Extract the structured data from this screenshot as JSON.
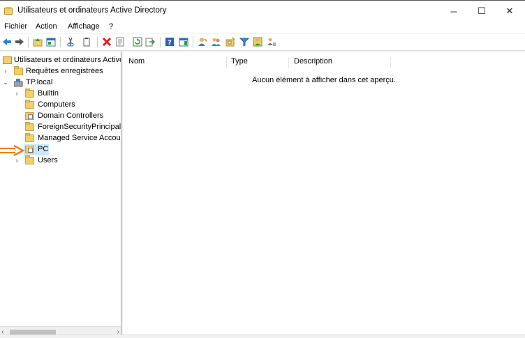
{
  "window": {
    "title": "Utilisateurs et ordinateurs Active Directory",
    "minimize_glyph": "─",
    "maximize_glyph": "☐",
    "close_glyph": "✕"
  },
  "menu": [
    {
      "label": "Fichier"
    },
    {
      "label": "Action"
    },
    {
      "label": "Affichage"
    },
    {
      "label": "?"
    }
  ],
  "toolbar": {
    "icons": [
      "back-arrow-icon",
      "forward-arrow-icon",
      "up-folder-icon",
      "show-console-tree-icon",
      "cut-icon",
      "copy-icon",
      "delete-icon",
      "properties-icon",
      "refresh-icon",
      "export-list-icon",
      "help-icon",
      "action-pane-icon",
      "new-user-icon",
      "new-group-icon",
      "new-ou-icon",
      "filter-icon",
      "add-to-group-icon",
      "delegate-icon"
    ]
  },
  "tree": {
    "root": "Utilisateurs et ordinateurs Active",
    "saved_queries": "Requêtes enregistrées",
    "domain": "TP.local",
    "containers": [
      {
        "label": "Builtin",
        "expandable": true,
        "type": "folder"
      },
      {
        "label": "Computers",
        "expandable": false,
        "type": "folder"
      },
      {
        "label": "Domain Controllers",
        "expandable": false,
        "type": "ou"
      },
      {
        "label": "ForeignSecurityPrincipals",
        "expandable": false,
        "type": "folder"
      },
      {
        "label": "Managed Service Accour",
        "expandable": false,
        "type": "folder"
      },
      {
        "label": "PC",
        "expandable": false,
        "type": "ou",
        "selected": true
      },
      {
        "label": "Users",
        "expandable": true,
        "type": "folder"
      }
    ],
    "expand_collapsed_glyph": "›",
    "expand_open_glyph": "⌄"
  },
  "list": {
    "columns": [
      "Nom",
      "Type",
      "Description"
    ],
    "empty_message": "Aucun élément à afficher dans cet aperçu."
  },
  "colors": {
    "annotation_arrow": "#f07c1c",
    "selection": "#cce8ff",
    "folder": "#f2cf6c"
  }
}
